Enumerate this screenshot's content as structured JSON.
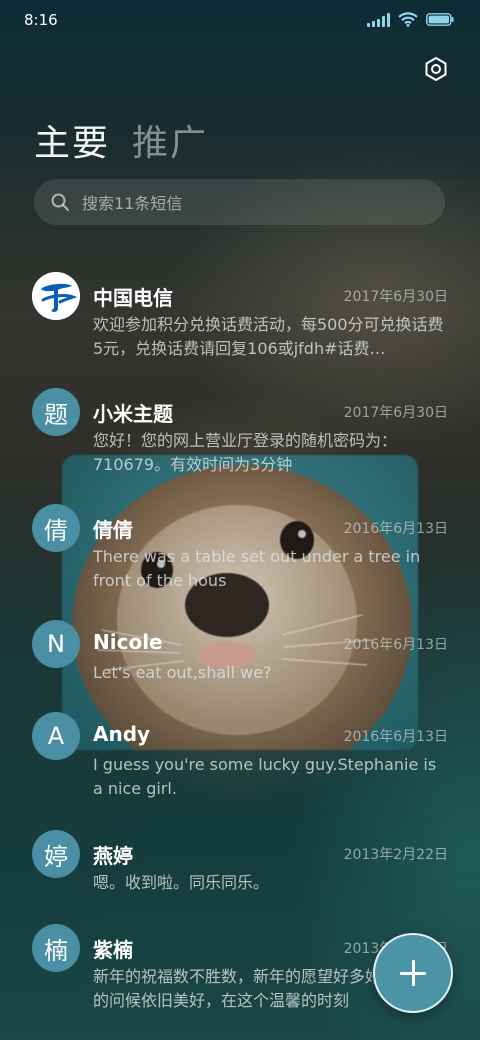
{
  "status_bar": {
    "time": "8:16"
  },
  "tabs": [
    {
      "label": "主要",
      "active": true
    },
    {
      "label": "推广",
      "active": false
    }
  ],
  "search": {
    "placeholder": "搜索11条短信"
  },
  "conversations": [
    {
      "avatar": "",
      "avatar_icon": "china-telecom-logo-icon",
      "sender": "中国电信",
      "date": "2017年6月30日",
      "preview": "欢迎参加积分兑换话费活动，每500分可兑换话费5元，兑换话费请回复106或jfdh#话费…"
    },
    {
      "avatar": "题",
      "sender": "小米主题",
      "date": "2017年6月30日",
      "preview": "您好！您的网上营业厅登录的随机密码为：710679。有效时间为3分钟"
    },
    {
      "avatar": "倩",
      "sender": "倩倩",
      "date": "2016年6月13日",
      "preview": "There was a table set out under a tree in front of the hous"
    },
    {
      "avatar": "N",
      "sender": "Nicole",
      "date": "2016年6月13日",
      "preview": "Let's eat out,shall we?"
    },
    {
      "avatar": "A",
      "sender": "Andy",
      "date": "2016年6月13日",
      "preview": "I guess you're some lucky guy.Stephanie is a nice girl."
    },
    {
      "avatar": "婷",
      "sender": "燕婷",
      "date": "2013年2月22日",
      "preview": "嗯。收到啦。同乐同乐。"
    },
    {
      "avatar": "楠",
      "sender": "紫楠",
      "date": "2013年2月22日",
      "preview": "新年的祝福数不胜数，新年的愿望好多好多，新年的问候依旧美好，在这个温馨的时刻"
    }
  ],
  "colors": {
    "avatar": "#4b8fa4",
    "fab": "#4b93a6",
    "telecom_blue": "#0a5fb4"
  }
}
